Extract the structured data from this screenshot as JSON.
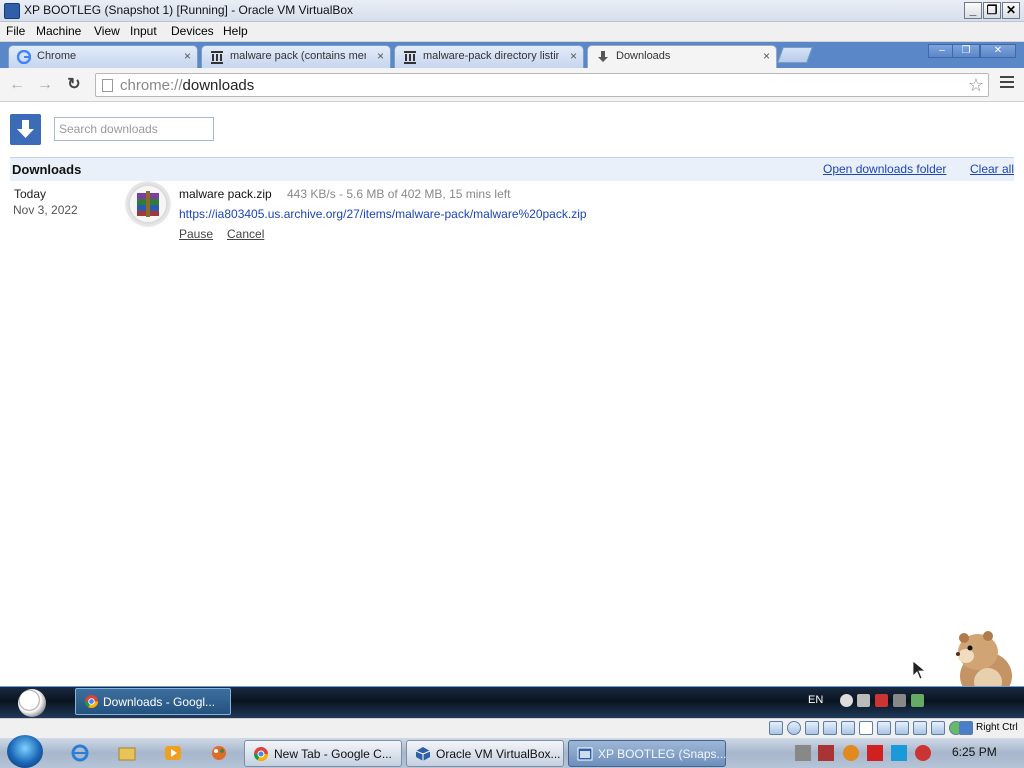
{
  "vb_window": {
    "title": "XP BOOTLEG (Snapshot 1) [Running] - Oracle VM VirtualBox",
    "controls": {
      "minimize": "_",
      "maximize": "❐",
      "close": "✕"
    }
  },
  "vb_menu": [
    "File",
    "Machine",
    "View",
    "Input",
    "Devices",
    "Help"
  ],
  "chrome": {
    "tabs": [
      {
        "title": "Chrome",
        "icon": "chrome-g-icon",
        "close": "×"
      },
      {
        "title": "malware pack (contains mem",
        "icon": "archive-org-icon",
        "close": "×"
      },
      {
        "title": "malware-pack directory listin",
        "icon": "archive-org-icon",
        "close": "×"
      },
      {
        "title": "Downloads",
        "icon": "download-arrow-icon",
        "close": "×"
      }
    ],
    "window_controls": {
      "minimize": "‒",
      "restore": "❐",
      "close": "✕"
    },
    "nav": {
      "back": "←",
      "forward": "→",
      "reload": "↻"
    },
    "omnibox": {
      "scheme": "chrome://",
      "path": "downloads",
      "star": "☆"
    }
  },
  "downloads_page": {
    "search_placeholder": "Search downloads",
    "heading": "Downloads",
    "open_folder": "Open downloads folder",
    "clear_all": "Clear all",
    "items": [
      {
        "date_label": "Today",
        "date": "Nov 3, 2022",
        "file_name": "malware pack.zip",
        "status": "443 KB/s - 5.6 MB of 402 MB, 15 mins left",
        "url": "https://ia803405.us.archive.org/27/items/malware-pack/malware%20pack.zip",
        "pause": "Pause",
        "cancel": "Cancel",
        "icon": "winrar-archive-icon"
      }
    ]
  },
  "guest_taskbar": {
    "window_button": "Downloads - Googl...",
    "language": "EN"
  },
  "vb_status": {
    "host_key": "Right Ctrl"
  },
  "host_taskbar": {
    "buttons": [
      {
        "label": "New Tab - Google C...",
        "icon": "chrome-icon"
      },
      {
        "label": "Oracle VM VirtualBox...",
        "icon": "virtualbox-icon"
      },
      {
        "label": "XP BOOTLEG (Snaps...",
        "icon": "vm-window-icon"
      }
    ],
    "clock": "6:25 PM"
  },
  "colors": {
    "link": "#1b45b5",
    "header_bg": "#eaf0fa",
    "tabstrip": "#5a87c8",
    "accent_blue": "#2f5ca8"
  }
}
